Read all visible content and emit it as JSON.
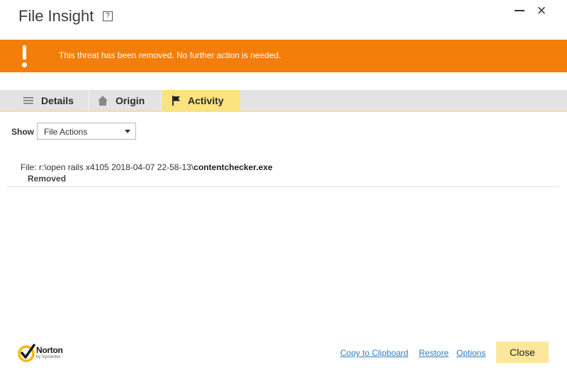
{
  "window": {
    "title": "File Insight",
    "help_label": "?",
    "close_glyph": "×"
  },
  "banner": {
    "icon": "exclamation-icon",
    "color": "#f47e0a",
    "message": "This threat has been removed. No further action is needed."
  },
  "tabs": [
    {
      "label": "Details",
      "icon": "list-icon",
      "active": false
    },
    {
      "label": "Origin",
      "icon": "home-icon",
      "active": false
    },
    {
      "label": "Activity",
      "icon": "flag-icon",
      "active": true
    }
  ],
  "filter": {
    "label": "Show",
    "selected": "File Actions"
  },
  "entries": [
    {
      "prefix": "File: r:\\open rails x4105 2018-04-07 22-58-13\\",
      "filename": "contentchecker.exe",
      "status": "Removed"
    }
  ],
  "footer": {
    "logo": {
      "icon": "norton-check-icon",
      "brand": "Norton",
      "sub": "by Symantec"
    },
    "links": {
      "copy": "Copy to Clipboard",
      "restore": "Restore",
      "options": "Options"
    },
    "close_label": "Close",
    "accent": "#fbe79a",
    "link_color": "#2c7fc3"
  }
}
